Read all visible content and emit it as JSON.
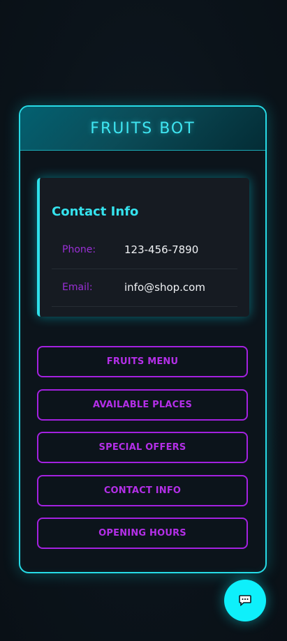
{
  "header": {
    "title": "FRUITS BOT"
  },
  "contact_card": {
    "title": "Contact Info",
    "rows": [
      {
        "label": "Phone:",
        "value": "123-456-7890"
      },
      {
        "label": "Email:",
        "value": "info@shop.com"
      }
    ]
  },
  "menu_buttons": [
    {
      "label": "FRUITS MENU"
    },
    {
      "label": "AVAILABLE PLACES"
    },
    {
      "label": "SPECIAL OFFERS"
    },
    {
      "label": "CONTACT INFO"
    },
    {
      "label": "OPENING HOURS"
    }
  ],
  "chat_button": {
    "icon": "chat-bubble-icon"
  },
  "colors": {
    "accent_cyan": "#27dbe6",
    "accent_purple": "#a421e0",
    "background": "#0b131a",
    "card_background": "#161b22"
  }
}
